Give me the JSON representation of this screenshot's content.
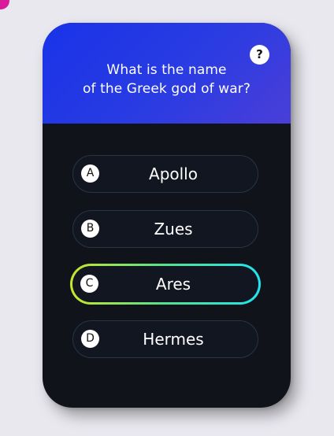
{
  "quiz": {
    "question_line1": "What is the name",
    "question_line2": "of the Greek god of war?",
    "help_label": "?",
    "answers": [
      {
        "letter": "A",
        "text": "Apollo",
        "selected": false
      },
      {
        "letter": "B",
        "text": "Zues",
        "selected": false
      },
      {
        "letter": "C",
        "text": "Ares",
        "selected": true
      },
      {
        "letter": "D",
        "text": "Hermes",
        "selected": false
      }
    ]
  },
  "colors": {
    "background": "#e9e8ef",
    "card": "#101319",
    "header_gradient_start": "#1933e8",
    "header_gradient_end": "#4a3ed8",
    "selected_gradient_start": "#c9e629",
    "selected_gradient_end": "#1fe6ee",
    "accent": "#d81b9b"
  },
  "icons": {
    "help": "question-mark-icon"
  }
}
